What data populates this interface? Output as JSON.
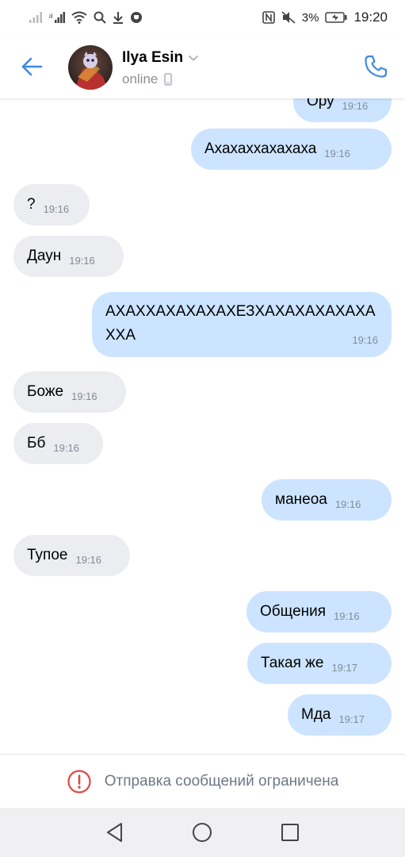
{
  "status_bar": {
    "battery_percent": "3%",
    "time": "19:20"
  },
  "header": {
    "contact_name": "Ilya Esin",
    "status": "online"
  },
  "messages": [
    {
      "direction": "out",
      "text": "Ору",
      "time": "19:16"
    },
    {
      "direction": "out",
      "text": "Ахахаххахахаха",
      "time": "19:16"
    },
    {
      "direction": "in",
      "text": "?",
      "time": "19:16"
    },
    {
      "direction": "in",
      "text": "Даун",
      "time": "19:16"
    },
    {
      "direction": "out",
      "text": "АХАХХАХАХАХАХЕЗХАХАХАХАХАХАХХА",
      "time": "19:16"
    },
    {
      "direction": "in",
      "text": "Боже",
      "time": "19:16"
    },
    {
      "direction": "in",
      "text": "Бб",
      "time": "19:16"
    },
    {
      "direction": "out",
      "text": "манеоа",
      "time": "19:16"
    },
    {
      "direction": "in",
      "text": "Тупое",
      "time": "19:16"
    },
    {
      "direction": "out",
      "text": "Общения",
      "time": "19:16"
    },
    {
      "direction": "out",
      "text": "Такая же",
      "time": "19:17"
    },
    {
      "direction": "out",
      "text": "Мда",
      "time": "19:17"
    }
  ],
  "restriction": {
    "text": "Отправка сообщений ограничена"
  },
  "colors": {
    "accent": "#3f8ae0",
    "incoming_bubble": "#ebedf0",
    "outgoing_bubble": "#cce4ff",
    "warning": "#e64646"
  },
  "icons": {
    "back": "arrow-left-icon",
    "call": "phone-icon",
    "warning": "exclamation-circle-icon",
    "nav_back": "triangle-back-icon",
    "nav_home": "circle-home-icon",
    "nav_recents": "square-recents-icon"
  }
}
